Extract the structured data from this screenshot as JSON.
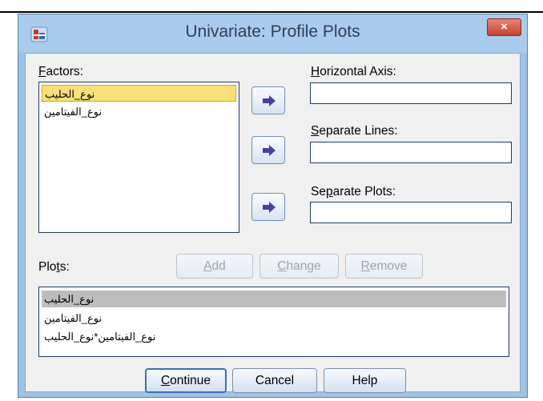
{
  "window": {
    "title": "Univariate: Profile Plots",
    "close_label": "×"
  },
  "factors": {
    "label_pre": "",
    "label_mnemonic": "F",
    "label_post": "actors:",
    "items": [
      "نوع_الحليب",
      "نوع_الفيتامين"
    ],
    "selected_index": 0
  },
  "horizontal_axis": {
    "label_pre": "",
    "label_mnemonic": "H",
    "label_post": "orizontal Axis:",
    "value": ""
  },
  "separate_lines": {
    "label_pre": "",
    "label_mnemonic": "S",
    "label_post": "eparate Lines:",
    "value": ""
  },
  "separate_plots": {
    "label_pre": "Se",
    "label_mnemonic": "p",
    "label_post": "arate Plots:",
    "value": ""
  },
  "plots": {
    "label_pre": "Plo",
    "label_mnemonic": "t",
    "label_post": "s:",
    "add_label_mnemonic": "A",
    "add_label_post": "dd",
    "change_label_mnemonic": "C",
    "change_label_post": "hange",
    "remove_label_mnemonic": "R",
    "remove_label_post": "emove",
    "items": [
      "نوع_الحليب",
      "نوع_الفيتامين",
      "نوع_الفيتامين*نوع_الحليب"
    ],
    "selected_index": 0
  },
  "footer": {
    "continue_mnemonic": "C",
    "continue_post": "ontinue",
    "cancel_label": "Cancel",
    "help_label": "Help"
  },
  "colors": {
    "accent": "#3a6fb3",
    "arrow": "#4a3f9c",
    "selection": "#f8df7a"
  }
}
